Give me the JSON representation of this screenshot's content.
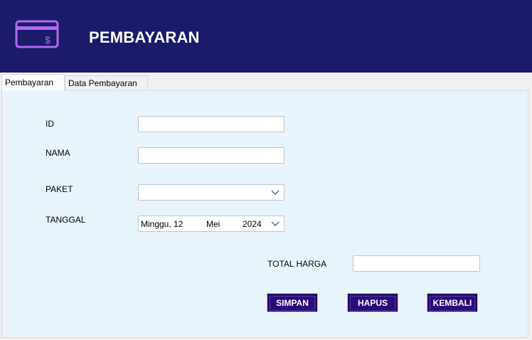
{
  "header": {
    "title": "PEMBAYARAN",
    "logo_icon": "payment-card-dollar-icon",
    "logo_symbol": "$",
    "background_color": "#1c1a6b",
    "icon_color": "#b06af0"
  },
  "tabs": [
    {
      "label": "Pembayaran",
      "active": true
    },
    {
      "label": "Data Pembayaran",
      "active": false
    }
  ],
  "form": {
    "id_label": "ID",
    "id_value": "",
    "nama_label": "NAMA",
    "nama_value": "",
    "paket_label": "PAKET",
    "paket_value": "",
    "tanggal_label": "TANGGAL",
    "tanggal_day": "Minggu, 12",
    "tanggal_month": "Mei",
    "tanggal_year": "2024",
    "total_label": "TOTAL HARGA",
    "total_value": ""
  },
  "buttons": {
    "simpan": "SIMPAN",
    "hapus": "HAPUS",
    "kembali": "KEMBALI"
  },
  "colors": {
    "panel": "#e8f4fb",
    "button": "#2b0a7a"
  }
}
